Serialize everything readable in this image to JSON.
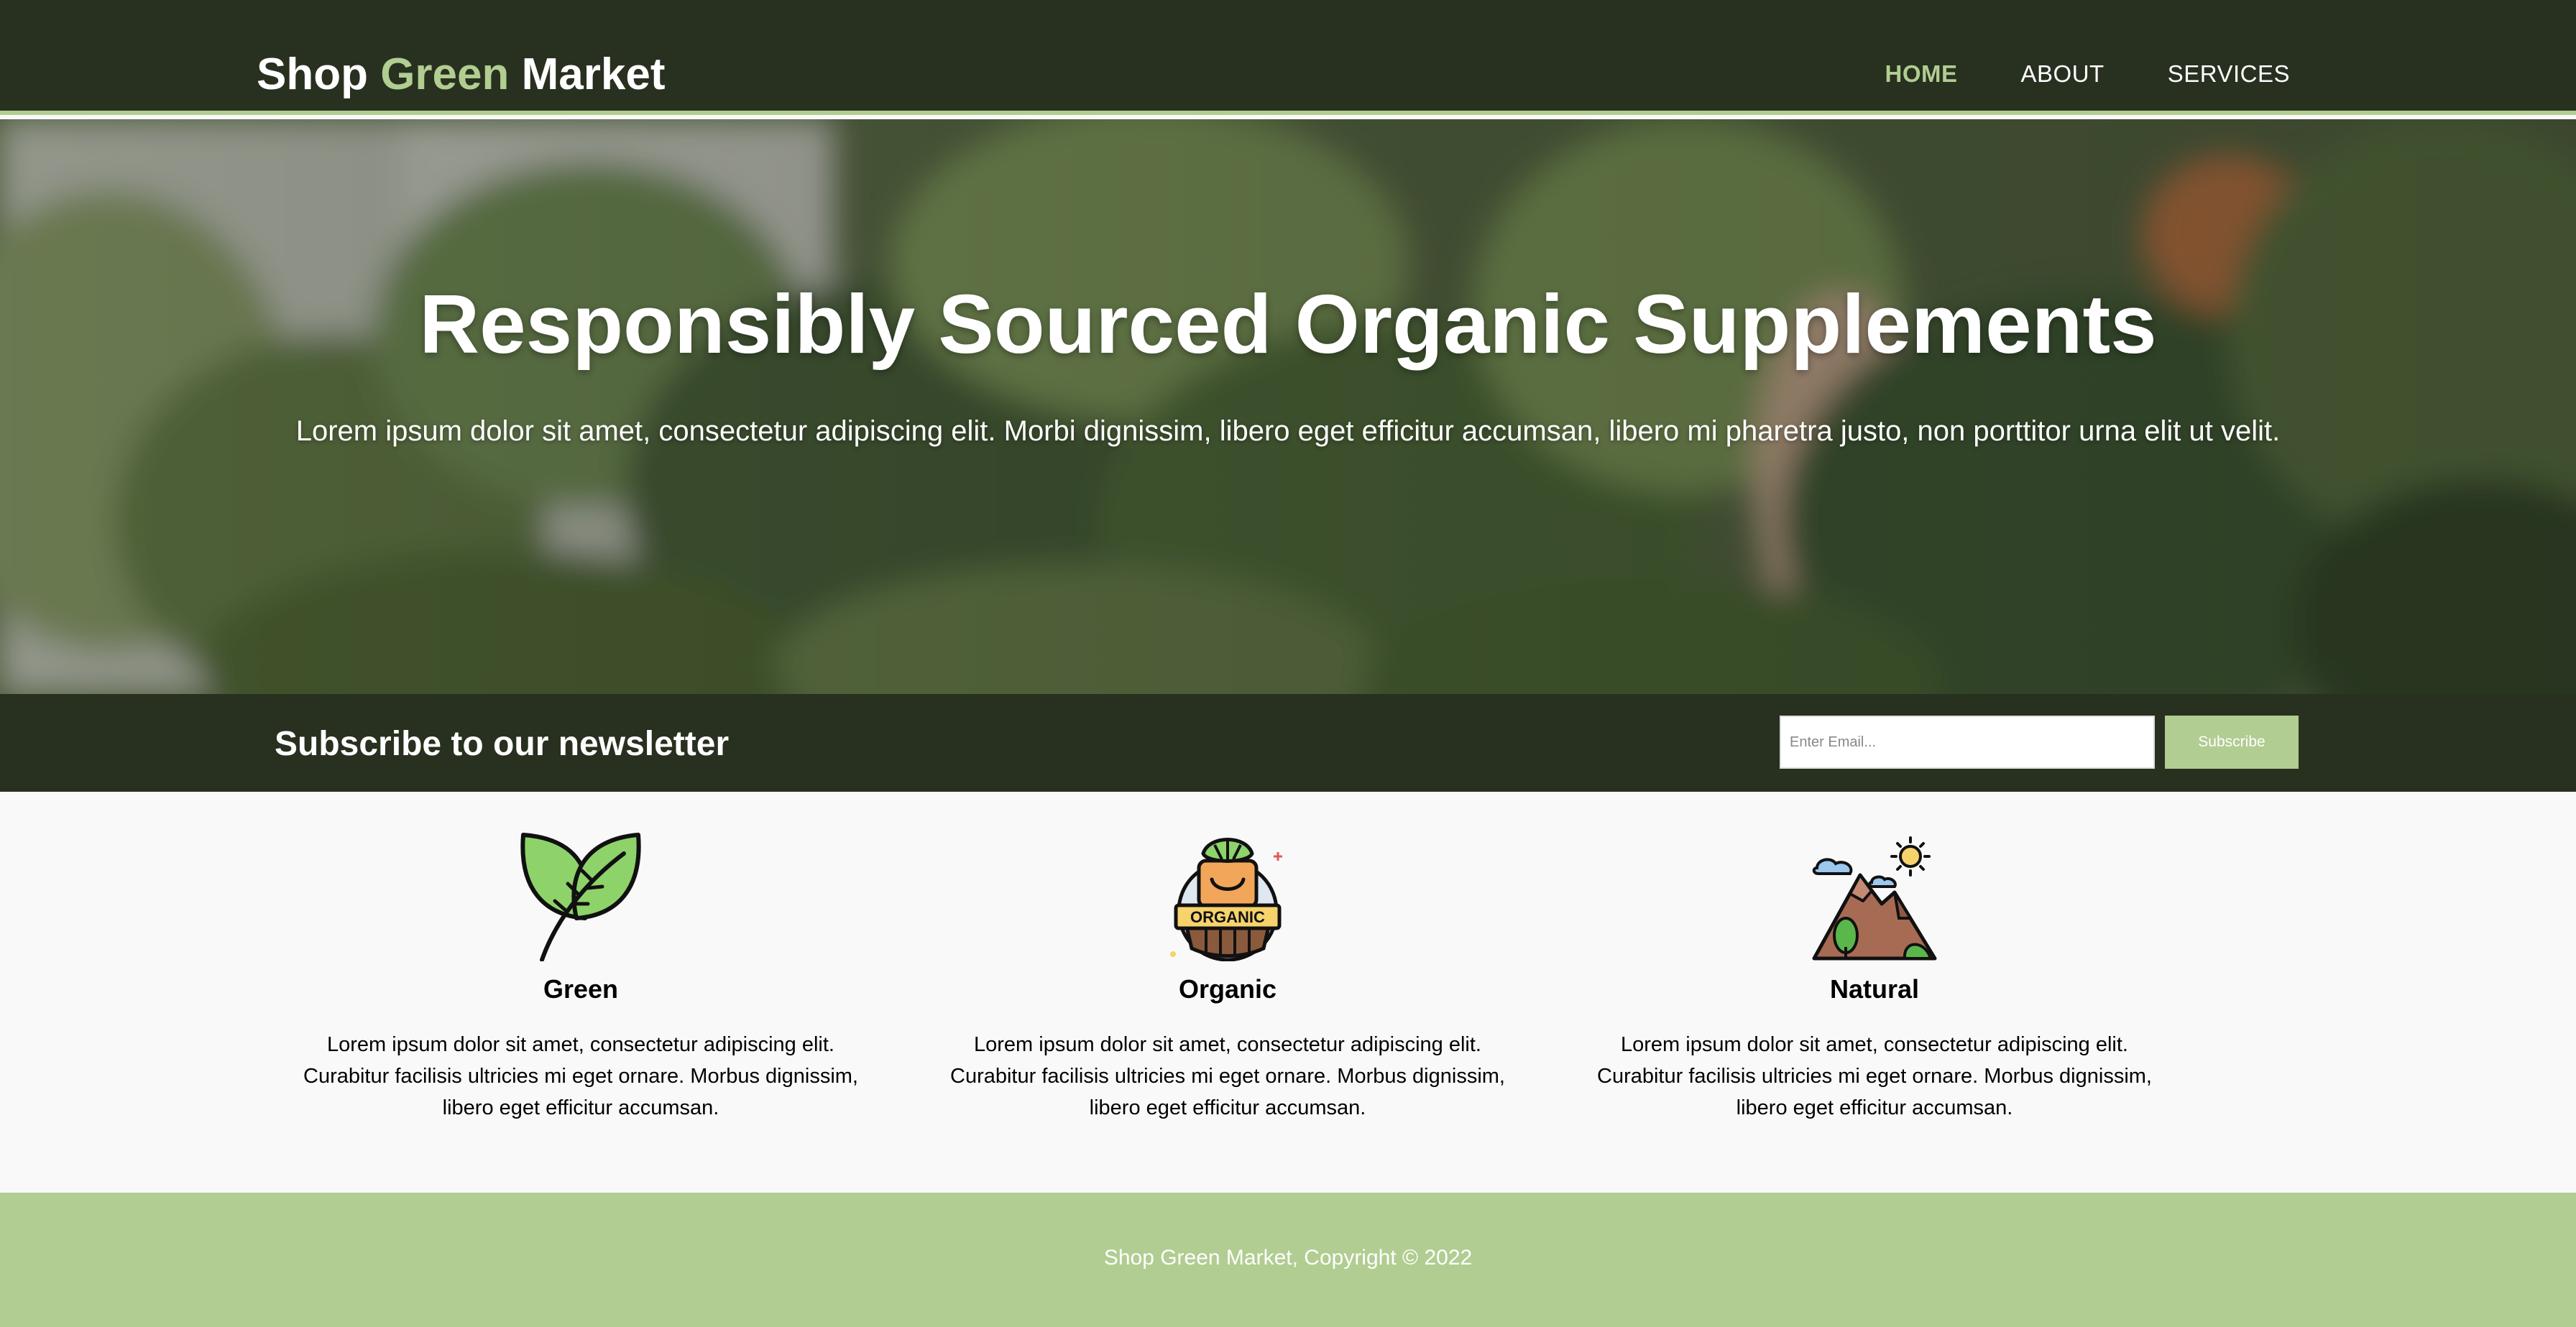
{
  "header": {
    "logo_part1": "Shop ",
    "logo_part2": "Green",
    "logo_part3": " Market",
    "nav": [
      {
        "label": "HOME",
        "active": true
      },
      {
        "label": "ABOUT",
        "active": false
      },
      {
        "label": "SERVICES",
        "active": false
      }
    ]
  },
  "hero": {
    "title": "Responsibly Sourced Organic Supplements",
    "text": "Lorem ipsum dolor sit amet, consectetur adipiscing elit. Morbi dignissim, libero eget efficitur accumsan, libero mi pharetra justo, non porttitor urna elit ut velit."
  },
  "newsletter": {
    "title": "Subscribe to our newsletter",
    "placeholder": "Enter Email...",
    "button_label": "Subscribe"
  },
  "features": [
    {
      "icon": "leaf-icon",
      "title": "Green",
      "text": "Lorem ipsum dolor sit amet, consectetur adipiscing elit. Curabitur facilisis ultricies mi eget ornare. Morbus dignissim, libero eget efficitur accumsan."
    },
    {
      "icon": "organic-badge-icon",
      "title": "Organic",
      "badge_text": "ORGANIC",
      "text": "Lorem ipsum dolor sit amet, consectetur adipiscing elit. Curabitur facilisis ultricies mi eget ornare. Morbus dignissim, libero eget efficitur accumsan."
    },
    {
      "icon": "mountain-icon",
      "title": "Natural",
      "text": "Lorem ipsum dolor sit amet, consectetur adipiscing elit. Curabitur facilisis ultricies mi eget ornare. Morbus dignissim, libero eget efficitur accumsan."
    }
  ],
  "footer": {
    "text": "Shop Green Market, Copyright © 2022"
  },
  "colors": {
    "dark": "#283020",
    "accent": "#b1cd91",
    "background": "#f9f9f9"
  }
}
